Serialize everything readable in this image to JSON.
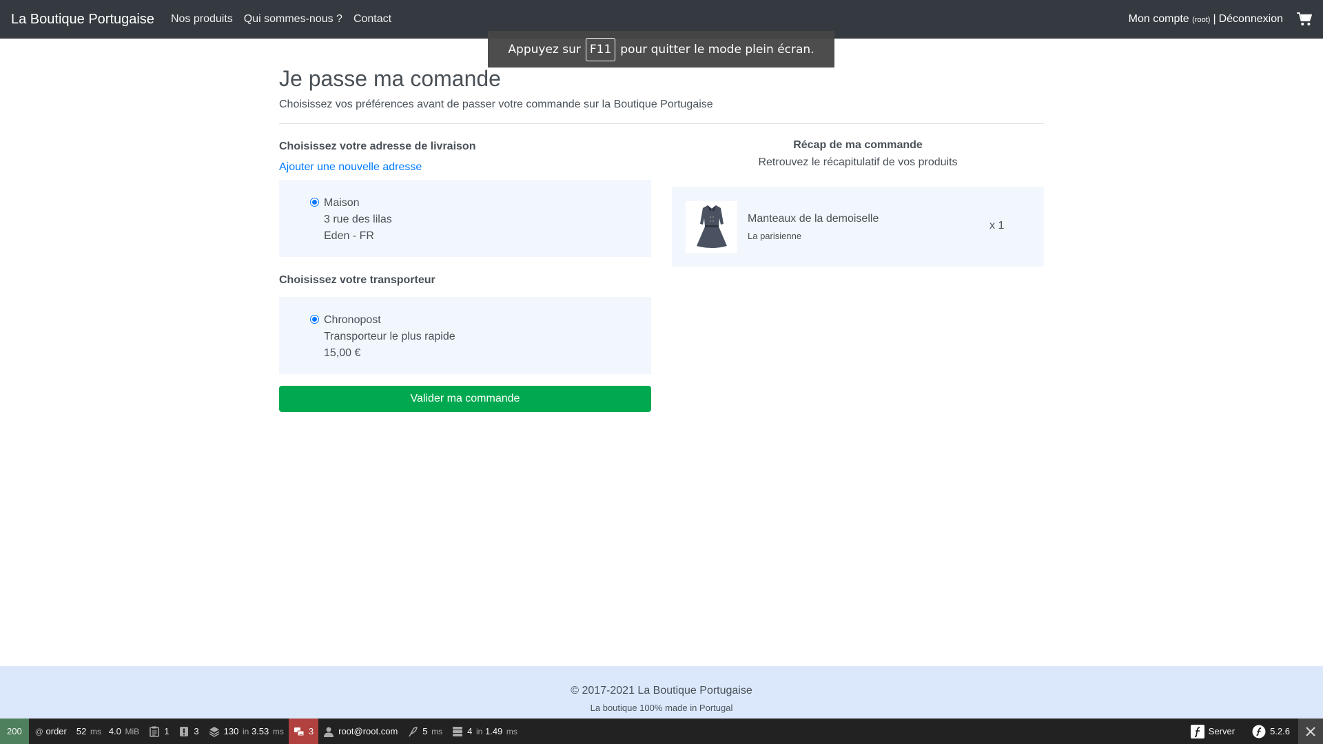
{
  "navbar": {
    "brand": "La Boutique Portugaise",
    "links": [
      "Nos produits",
      "Qui sommes-nous ?",
      "Contact"
    ],
    "account": "Mon compte",
    "account_user": "(root)",
    "separator": "|",
    "logout": "Déconnexion"
  },
  "fullscreen_notice": {
    "before": "Appuyez sur",
    "key": "F11",
    "after": "pour quitter le mode plein écran."
  },
  "page": {
    "title": "Je passe ma comande",
    "subtitle": "Choisissez vos préférences avant de passer votre commande sur la Boutique Portugaise"
  },
  "address": {
    "heading": "Choisissez votre adresse de livraison",
    "add_link": "Ajouter une nouvelle adresse",
    "selected": {
      "name": "Maison",
      "line1": "3 rue des lilas",
      "line2": "Eden - FR"
    }
  },
  "carrier": {
    "heading": "Choisissez votre transporteur",
    "selected": {
      "name": "Chronopost",
      "description": "Transporteur le plus rapide",
      "price": "15,00 €"
    }
  },
  "submit_label": "Valider ma commande",
  "recap": {
    "title": "Récap de ma commande",
    "subtitle": "Retrouvez le récapitulatif de vos produits",
    "items": [
      {
        "name": "Manteaux de la demoiselle",
        "brand": "La parisienne",
        "qty": "x 1"
      }
    ]
  },
  "footer": {
    "copyright": "© 2017-2021 La Boutique Portugaise",
    "tagline": "La boutique 100% made in Portugal"
  },
  "toolbar": {
    "status": "200",
    "route_prefix": "@",
    "route": "order",
    "time_value": "52",
    "time_unit": "ms",
    "memory_value": "4.0",
    "memory_unit": "MiB",
    "logs": "1",
    "exceptions": "3",
    "twig_value": "130",
    "twig_in": "in",
    "twig_time": "3.53",
    "twig_unit": "ms",
    "translations": "3",
    "user": "root@root.com",
    "cache_value": "5",
    "cache_unit": "ms",
    "db_value": "4",
    "db_in": "in",
    "db_time": "1.49",
    "db_unit": "ms",
    "server": "Server",
    "version": "5.2.6"
  },
  "colors": {
    "navbar_bg": "#343a40",
    "option_bg": "#f2f7fd",
    "button_green": "#00a94f",
    "link_blue": "#007bff",
    "footer_bg": "#dbe8fc",
    "toolbar_bg": "#222222",
    "status_green": "#4f805d",
    "toolbar_red": "#b0413e"
  }
}
